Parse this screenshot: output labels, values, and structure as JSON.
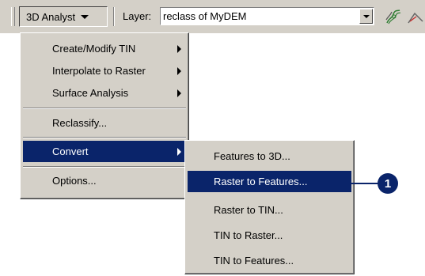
{
  "toolbar": {
    "menu_label": "3D Analyst",
    "layer_label": "Layer:",
    "layer_value": "reclass of MyDEM",
    "tool_icons": [
      "contour-tool-icon",
      "line-of-sight-tool-icon"
    ]
  },
  "main_menu": {
    "items": [
      {
        "label": "Create/Modify TIN",
        "submenu": true
      },
      {
        "label": "Interpolate to Raster",
        "submenu": true
      },
      {
        "label": "Surface Analysis",
        "submenu": true
      },
      {
        "label": "Reclassify...",
        "submenu": false
      },
      {
        "label": "Convert",
        "submenu": true,
        "selected": true
      },
      {
        "label": "Options...",
        "submenu": false
      }
    ]
  },
  "sub_menu": {
    "items": [
      {
        "label": "Features to 3D..."
      },
      {
        "label": "Raster to Features...",
        "selected": true
      },
      {
        "label": "Raster to TIN..."
      },
      {
        "label": "TIN to Raster..."
      },
      {
        "label": "TIN to Features..."
      }
    ]
  },
  "callout": {
    "number": "1"
  },
  "colors": {
    "selection": "#0a246a",
    "menu_bg": "#d4d0c8"
  }
}
